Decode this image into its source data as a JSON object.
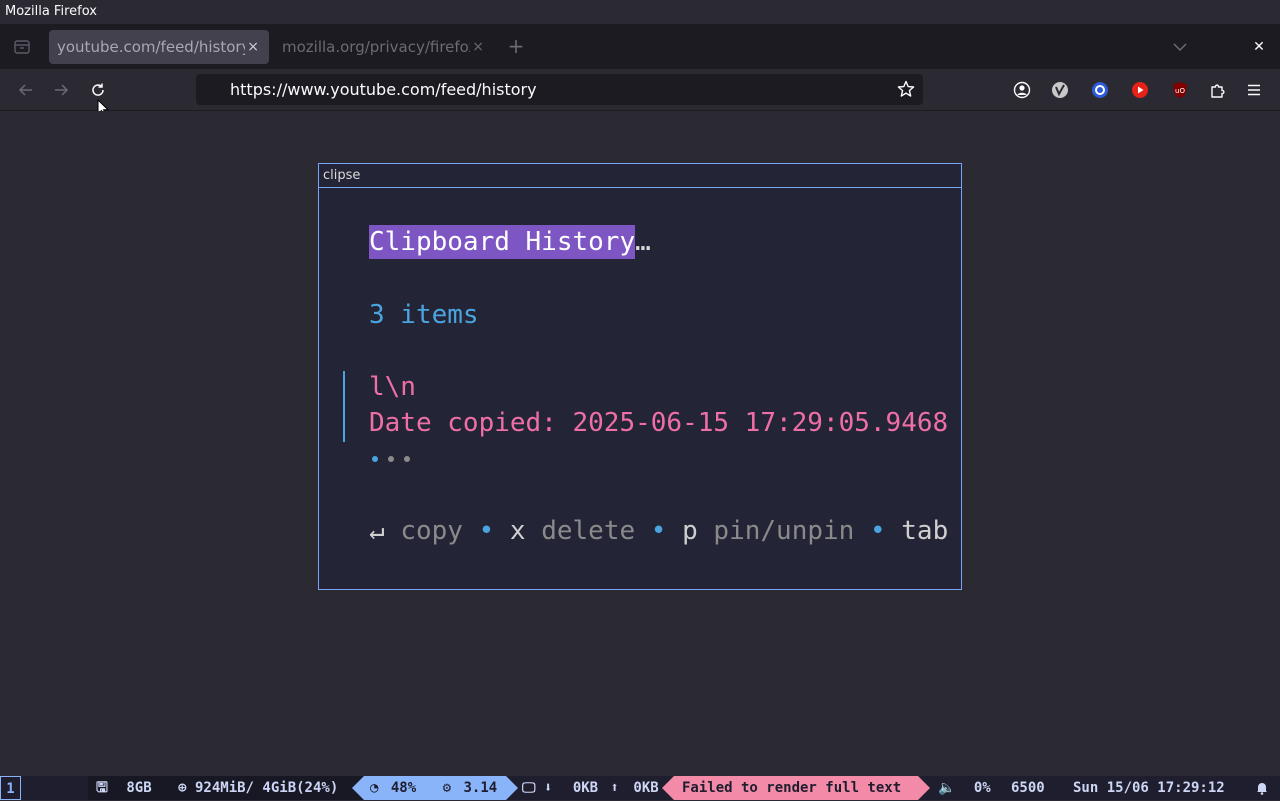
{
  "window": {
    "title": "Mozilla Firefox"
  },
  "tabs": [
    {
      "label": "youtube.com/feed/history",
      "active": true
    },
    {
      "label": "mozilla.org/privacy/firefox",
      "active": false
    }
  ],
  "tab_close_glyph": "×",
  "new_tab_glyph": "+",
  "window_close_glyph": "✕",
  "nav": {
    "url": "https://www.youtube.com/feed/history"
  },
  "toolbar_icons": [
    "account-icon",
    "extension-v-icon",
    "extension-circle-icon",
    "youtube-extension-icon",
    "ublock-icon",
    "extensions-puzzle-icon",
    "menu-hamburger-icon"
  ],
  "clipse": {
    "window_title": "clipse",
    "heading": "Clipboard History",
    "heading_ellipsis": "…",
    "count_text": "3 items",
    "selected_item": {
      "text": "l\\n",
      "date_line": "Date copied: 2025-06-15 17:29:05.9468"
    },
    "pagination_dots": {
      "total": 3,
      "active_index": 0,
      "active_color": "#4aa4e0",
      "inactive_color": "#8a8a8a"
    },
    "help": [
      {
        "key": "↵",
        "action": "copy"
      },
      {
        "key": "x",
        "action": "delete"
      },
      {
        "key": "p",
        "action": "pin/unpin"
      },
      {
        "key": "tab",
        "action": ""
      }
    ],
    "help_separator": "•"
  },
  "statusbar": {
    "workspace": "1",
    "memory_total": "8GB",
    "memory_used": "924MiB/ 4GiB(24%)",
    "cpu": "48%",
    "load": "3.14",
    "disk_down": "0KB",
    "disk_up": "0KB",
    "error": "Failed to render full text",
    "volume": "0%",
    "brightness": "6500",
    "datetime": "Sun 15/06 17:29:12"
  },
  "colors": {
    "accent": "#7aa2f7",
    "highlight": "#7d56c4",
    "pink": "#ee6fa6",
    "blue": "#4aa4e0"
  }
}
